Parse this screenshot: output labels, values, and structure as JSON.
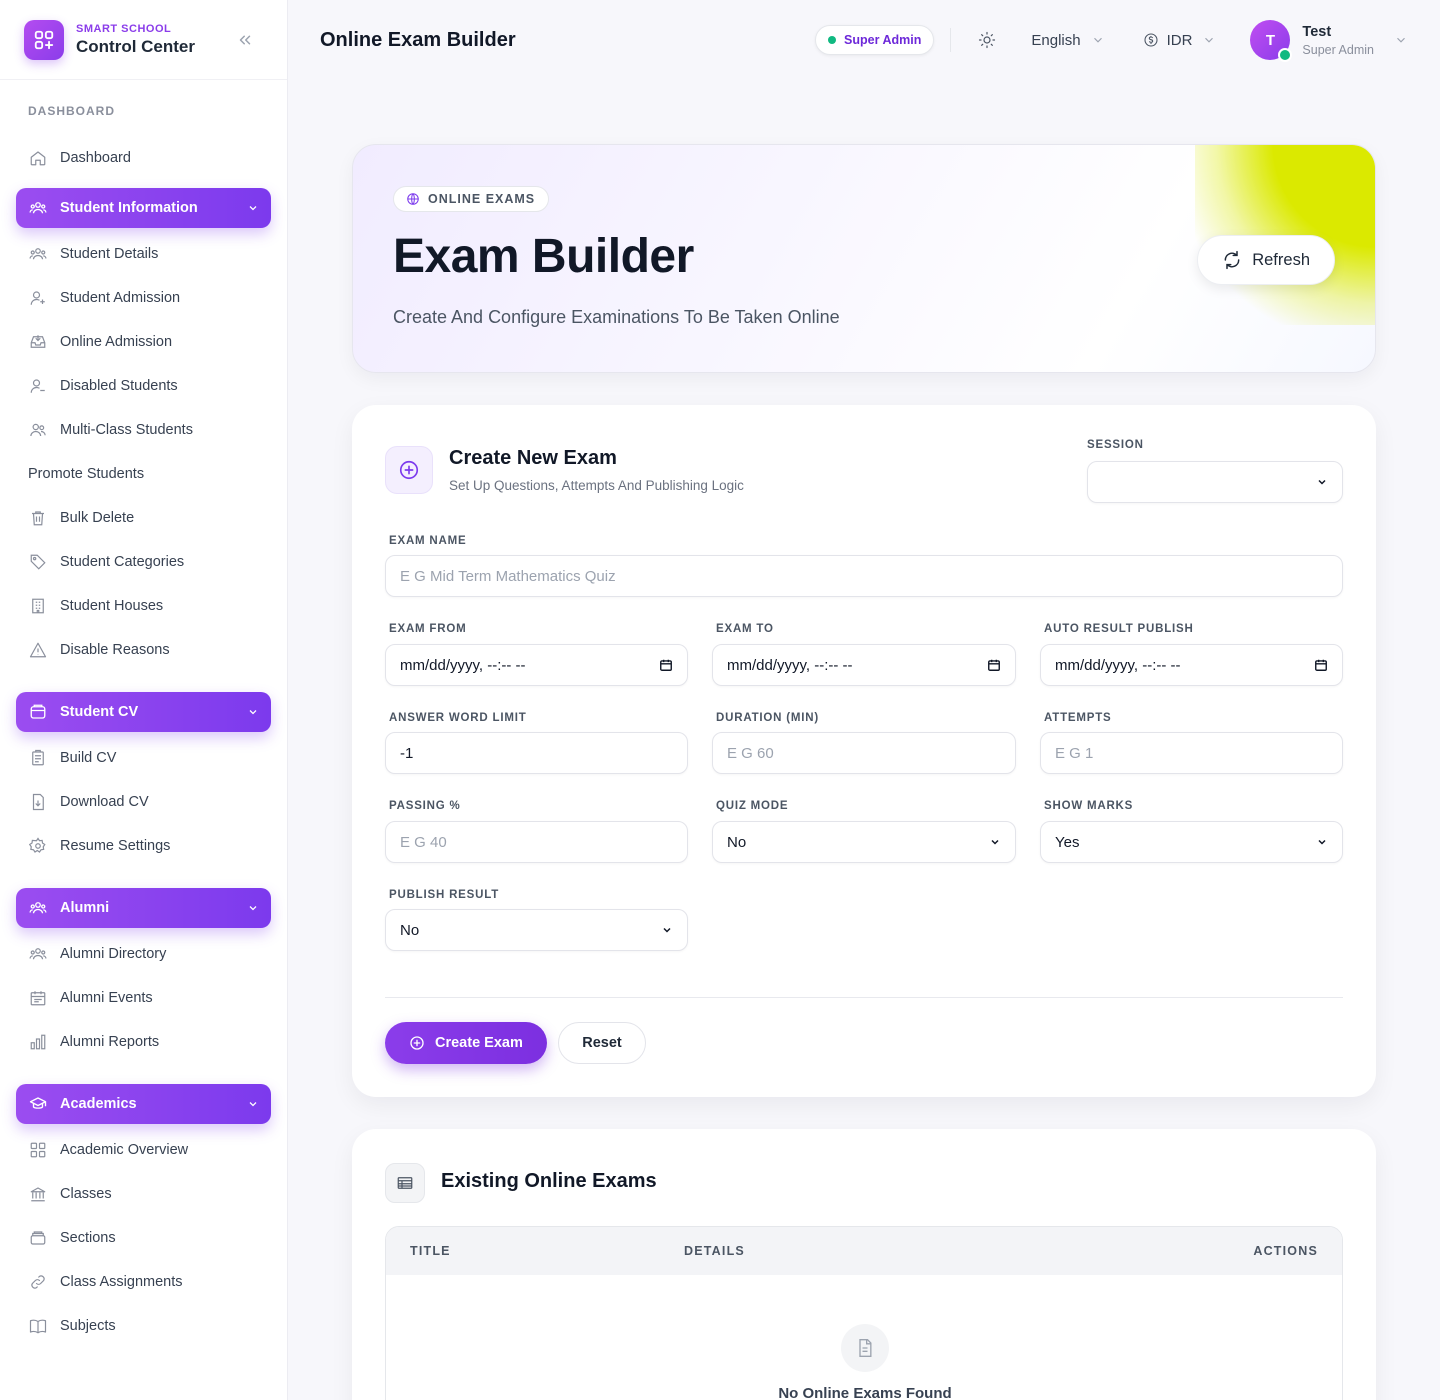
{
  "brand": {
    "subtitle": "SMART SCHOOL",
    "title": "Control Center"
  },
  "sidebar": {
    "heading": "DASHBOARD",
    "dashboard": {
      "label": "Dashboard",
      "icon": "home-icon"
    },
    "groups": [
      {
        "label": "Student Information",
        "icon": "users-icon",
        "items": [
          {
            "label": "Student Details",
            "icon": "users-icon"
          },
          {
            "label": "Student Admission",
            "icon": "user-plus-icon"
          },
          {
            "label": "Online Admission",
            "icon": "inbox-icon"
          },
          {
            "label": "Disabled Students",
            "icon": "user-minus-icon"
          },
          {
            "label": "Multi-Class Students",
            "icon": "user-group-icon"
          },
          {
            "label": "Promote Students",
            "icon": ""
          },
          {
            "label": "Bulk Delete",
            "icon": "trash-icon"
          },
          {
            "label": "Student Categories",
            "icon": "tag-icon"
          },
          {
            "label": "Student Houses",
            "icon": "building-icon"
          },
          {
            "label": "Disable Reasons",
            "icon": "warning-icon"
          }
        ]
      },
      {
        "label": "Student CV",
        "icon": "archive-icon",
        "items": [
          {
            "label": "Build CV",
            "icon": "clipboard-icon"
          },
          {
            "label": "Download CV",
            "icon": "file-download-icon"
          },
          {
            "label": "Resume Settings",
            "icon": "gear-icon"
          }
        ]
      },
      {
        "label": "Alumni",
        "icon": "users-icon",
        "items": [
          {
            "label": "Alumni Directory",
            "icon": "users-icon"
          },
          {
            "label": "Alumni Events",
            "icon": "calendar-icon"
          },
          {
            "label": "Alumni Reports",
            "icon": "bar-chart-icon"
          }
        ]
      },
      {
        "label": "Academics",
        "icon": "graduation-cap-icon",
        "items": [
          {
            "label": "Academic Overview",
            "icon": "grid-icon"
          },
          {
            "label": "Classes",
            "icon": "bank-icon"
          },
          {
            "label": "Sections",
            "icon": "layers-icon"
          },
          {
            "label": "Class Assignments",
            "icon": "link-icon"
          },
          {
            "label": "Subjects",
            "icon": "book-icon"
          }
        ]
      }
    ]
  },
  "topbar": {
    "title": "Online Exam Builder",
    "role_badge": "Super Admin",
    "language": "English",
    "currency": "IDR",
    "user": {
      "initial": "T",
      "name": "Test",
      "role": "Super Admin"
    }
  },
  "hero": {
    "badge": "ONLINE EXAMS",
    "title": "Exam Builder",
    "subtitle": "Create And Configure Examinations To Be Taken Online",
    "refresh_label": "Refresh"
  },
  "form": {
    "title": "Create New Exam",
    "subtitle": "Set Up Questions, Attempts And Publishing Logic",
    "session": {
      "label": "SESSION",
      "value": ""
    },
    "exam_name": {
      "label": "EXAM NAME",
      "placeholder": "E G Mid Term Mathematics Quiz"
    },
    "exam_from": {
      "label": "EXAM FROM",
      "value": "mm/dd/yyyy, --:-- --"
    },
    "exam_to": {
      "label": "EXAM TO",
      "value": "mm/dd/yyyy, --:-- --"
    },
    "auto_result_publish": {
      "label": "AUTO RESULT PUBLISH",
      "value": "mm/dd/yyyy, --:-- --"
    },
    "answer_word_limit": {
      "label": "ANSWER WORD LIMIT",
      "value": "-1"
    },
    "duration": {
      "label": "DURATION (MIN)",
      "placeholder": "E G 60"
    },
    "attempts": {
      "label": "ATTEMPTS",
      "placeholder": "E G 1"
    },
    "passing": {
      "label": "PASSING %",
      "placeholder": "E G 40"
    },
    "quiz_mode": {
      "label": "QUIZ MODE",
      "value": "No"
    },
    "show_marks": {
      "label": "SHOW MARKS",
      "value": "Yes"
    },
    "publish_result": {
      "label": "PUBLISH RESULT",
      "value": "No"
    },
    "create_label": "Create Exam",
    "reset_label": "Reset"
  },
  "exams_list": {
    "title": "Existing Online Exams",
    "columns": [
      "TITLE",
      "DETAILS",
      "ACTIONS"
    ],
    "empty_text": "No Online Exams Found"
  },
  "colors": {
    "accent": "#7c3aed",
    "accent_light": "#9b4df0",
    "online": "#10b981",
    "hero_deco": "#dbe900"
  }
}
